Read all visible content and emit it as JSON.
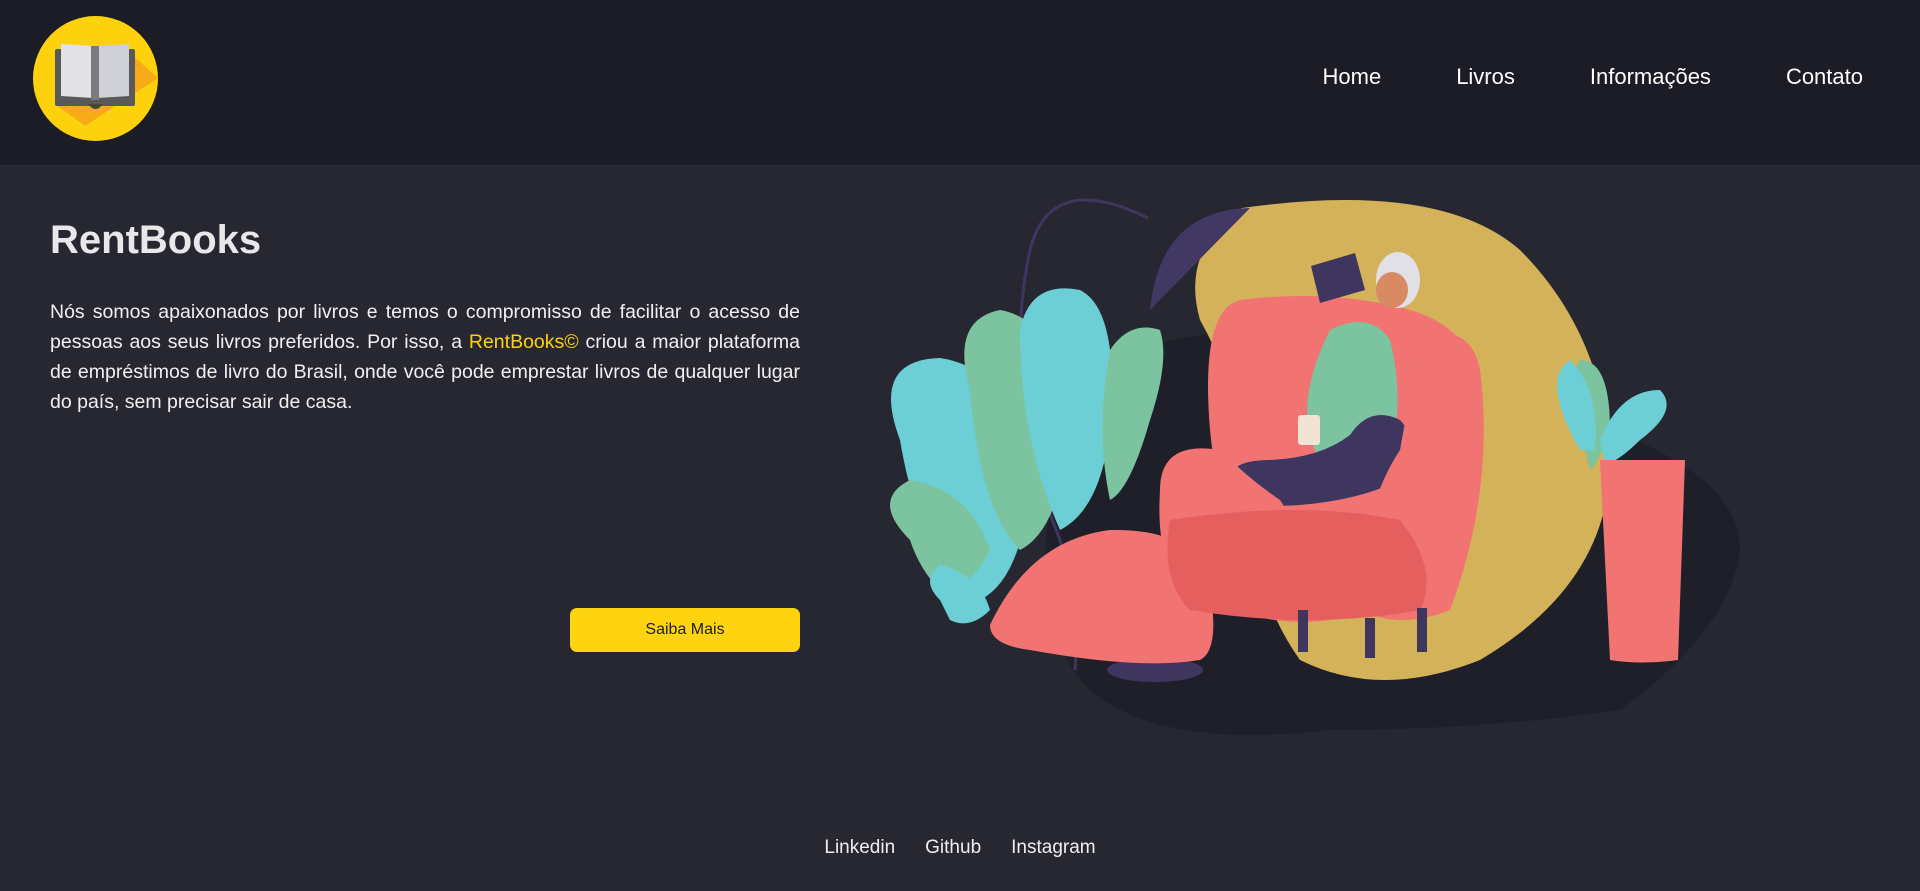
{
  "header": {
    "logo_icon": "book-icon",
    "nav": [
      {
        "label": "Home"
      },
      {
        "label": "Livros"
      },
      {
        "label": "Informações"
      },
      {
        "label": "Contato"
      }
    ]
  },
  "hero": {
    "title": "RentBooks",
    "paragraph_before": "Nós somos apaixonados por livros e temos o compromisso de facilitar o acesso de pessoas aos seus livros preferidos. Por isso, a ",
    "brand": "RentBooks©",
    "paragraph_after": " criou a maior plataforma de empréstimos de livro do Brasil, onde você pode emprestar livros de qualquer lugar do país, sem precisar sair de casa.",
    "cta_label": "Saiba Mais",
    "illustration_icon": "person-reading-illustration"
  },
  "footer": {
    "links": [
      {
        "label": "Linkedin"
      },
      {
        "label": "Github"
      },
      {
        "label": "Instagram"
      }
    ]
  },
  "colors": {
    "background": "#272732",
    "header_background": "#1c1c26",
    "accent": "#fdd20c",
    "logo_circle": "#fdd20c",
    "chair": "#f17473",
    "blob": "#d3b25a",
    "plant_teal": "#6ccfd6",
    "plant_green": "#7cc4a0",
    "lamp": "#3f3660"
  }
}
